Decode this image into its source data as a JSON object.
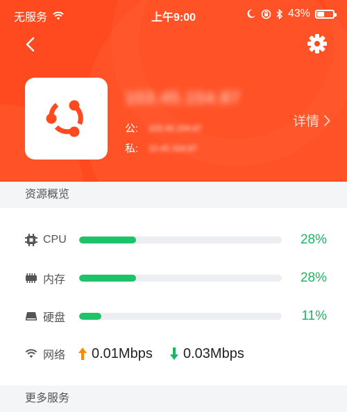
{
  "status_bar": {
    "carrier": "无服务",
    "time": "上午9:00",
    "battery": "43%",
    "battery_level": 0.43
  },
  "server": {
    "name": "103.45.154.87",
    "public_label": "公:",
    "public_ip": "103.45.154.87",
    "private_label": "私:",
    "private_ip": "10.45.154.87",
    "detail_label": "详情"
  },
  "sections": {
    "overview_title": "资源概览",
    "more_title": "更多服务"
  },
  "resources": [
    {
      "label": "CPU",
      "percent": "28%",
      "fill": 0.28,
      "icon": "cpu-chip-icon"
    },
    {
      "label": "内存",
      "percent": "28%",
      "fill": 0.28,
      "icon": "memory-icon"
    },
    {
      "label": "硬盘",
      "percent": "11%",
      "fill": 0.11,
      "icon": "disk-icon"
    }
  ],
  "network": {
    "label": "网络",
    "upload": "0.01Mbps",
    "download": "0.03Mbps"
  },
  "colors": {
    "header_bg": "#ff4a1f",
    "progress_fill": "#1dc368",
    "upload_arrow": "#ff8a00",
    "download_arrow": "#19b861"
  }
}
